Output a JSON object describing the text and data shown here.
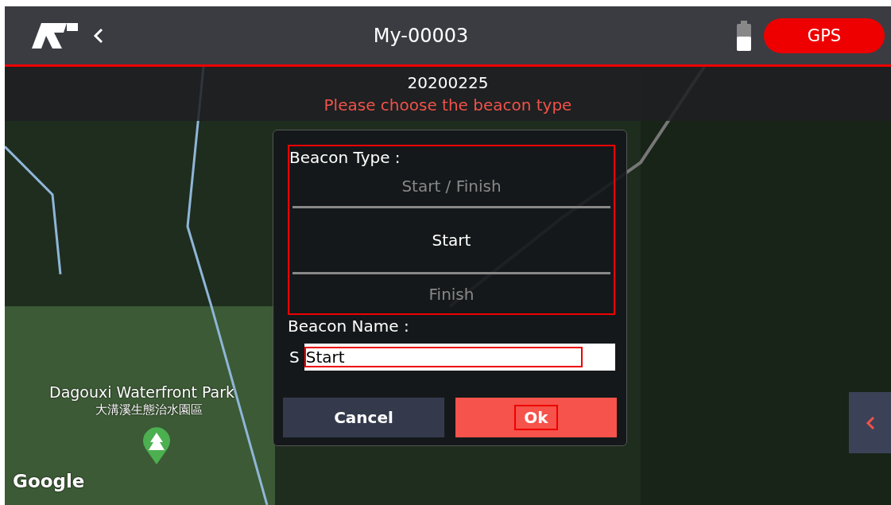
{
  "top_bar": {
    "title": "My-00003",
    "gps_button": "GPS"
  },
  "banner": {
    "date": "20200225",
    "prompt": "Please choose the beacon type"
  },
  "map": {
    "place_name": "Dagouxi Waterfront Park",
    "place_name_local": "大溝溪生態治水園區",
    "attribution": "Google"
  },
  "dialog": {
    "type_label": "Beacon Type :",
    "options": [
      {
        "label": "Start / Finish",
        "selected": false
      },
      {
        "label": "Start",
        "selected": true
      },
      {
        "label": "Finish",
        "selected": false
      }
    ],
    "name_label": "Beacon Name :",
    "name_prefix": "S",
    "name_value": "Start",
    "buttons": [
      {
        "label": "Cancel",
        "kind": "secondary"
      },
      {
        "label": "Ok",
        "kind": "primary"
      }
    ]
  }
}
